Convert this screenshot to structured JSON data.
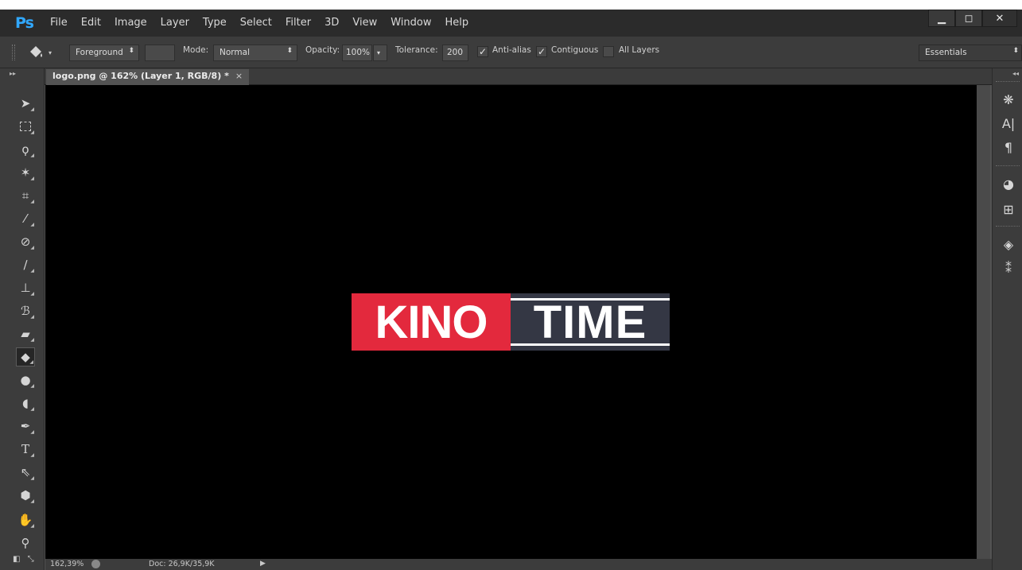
{
  "app": {
    "logo": "Ps"
  },
  "menu": [
    "File",
    "Edit",
    "Image",
    "Layer",
    "Type",
    "Select",
    "Filter",
    "3D",
    "View",
    "Window",
    "Help"
  ],
  "window_controls": {
    "minimize": "▁",
    "restore": "◻",
    "close": "✕"
  },
  "options_bar": {
    "fill_source": "Foreground",
    "mode_label": "Mode:",
    "mode_value": "Normal",
    "opacity_label": "Opacity:",
    "opacity_value": "100%",
    "tolerance_label": "Tolerance:",
    "tolerance_value": "200",
    "anti_alias_label": "Anti-alias",
    "anti_alias_checked": true,
    "contiguous_label": "Contiguous",
    "contiguous_checked": true,
    "all_layers_label": "All Layers",
    "all_layers_checked": false,
    "workspace": "Essentials"
  },
  "document_tab": {
    "title": "logo.png @ 162% (Layer 1, RGB/8) *",
    "close": "×"
  },
  "tools": [
    "move-tool",
    "marquee-tool",
    "lasso-tool",
    "magic-wand-tool",
    "crop-tool",
    "eyedropper-tool",
    "spot-healing-tool",
    "brush-tool",
    "clone-stamp-tool",
    "history-brush-tool",
    "eraser-tool",
    "paint-bucket-tool",
    "blur-tool",
    "dodge-tool",
    "pen-tool",
    "type-tool",
    "path-selection-tool",
    "shape-tool",
    "hand-tool",
    "zoom-tool"
  ],
  "active_tool": "paint-bucket-tool",
  "canvas": {
    "logo_left_text": "KINO",
    "logo_right_text": "TIME",
    "logo_left_color": "#e3293d",
    "logo_right_color": "#343744"
  },
  "status_bar": {
    "zoom": "162,39%",
    "doc_info": "Doc: 26,9K/35,9K",
    "arrow": "▶"
  }
}
